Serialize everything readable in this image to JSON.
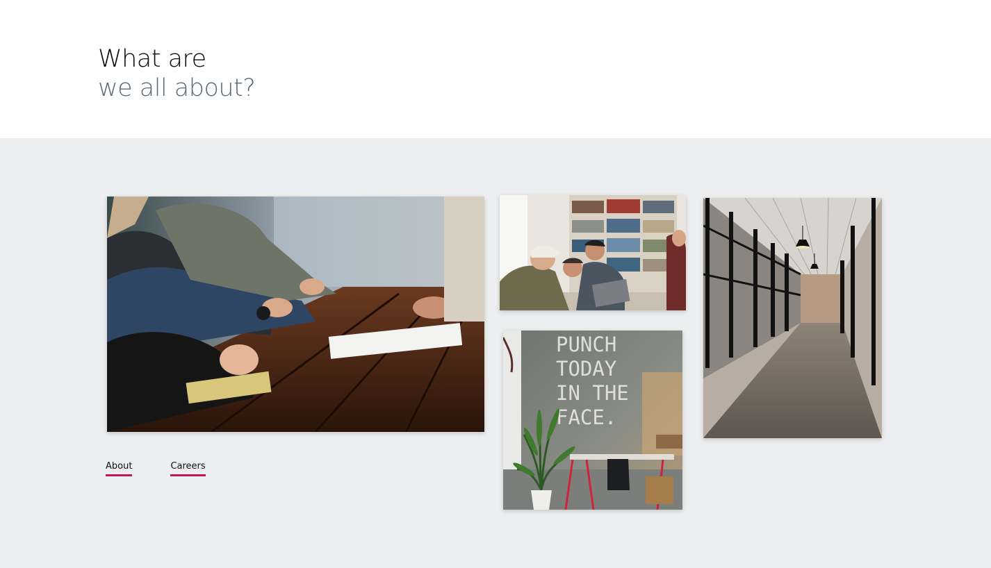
{
  "header": {
    "title_line1": "What are",
    "title_line2": "we all about?"
  },
  "gallery": {
    "images": [
      {
        "name": "meeting-table-photo",
        "description": "People writing at wooden table"
      },
      {
        "name": "library-team-photo",
        "description": "Team at laptop in front of bookshelves"
      },
      {
        "name": "office-hallway-photo",
        "description": "Glass-walled office corridor with pendant lamps"
      },
      {
        "name": "punch-today-photo",
        "description": "Wall painted with text PUNCH TODAY IN THE FACE."
      }
    ],
    "wall_text": [
      "PUNCH",
      "TODAY",
      "IN THE",
      "FACE."
    ]
  },
  "links": {
    "about": "About",
    "careers": "Careers"
  },
  "colors": {
    "accent": "#c2185b",
    "heading_dark": "#0a0a0a",
    "heading_muted": "#5b6a78",
    "gallery_bg": "#eceef0"
  }
}
